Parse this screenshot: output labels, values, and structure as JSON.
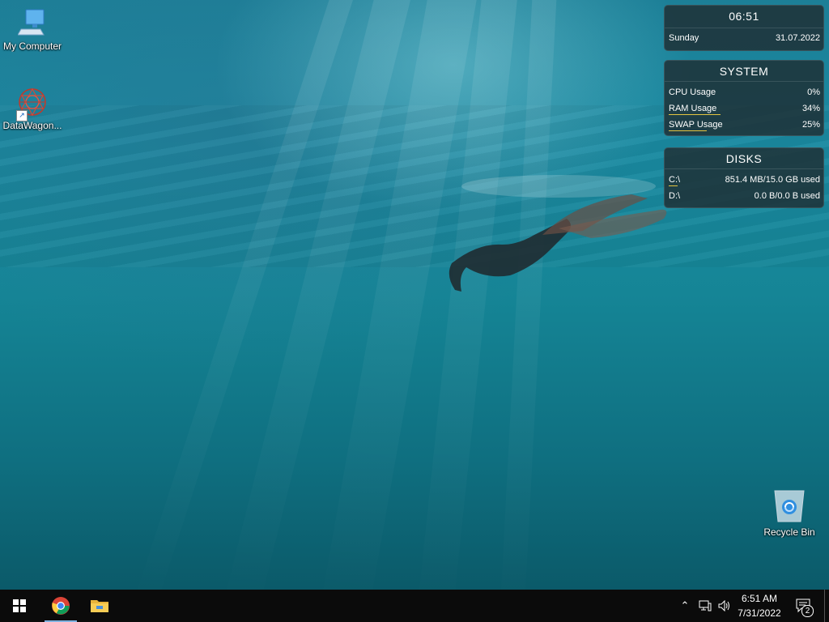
{
  "desktop": {
    "icons": [
      {
        "label": "My Computer",
        "icon": "computer-icon"
      },
      {
        "label": "DataWagon...",
        "icon": "datawagon-app-icon"
      },
      {
        "label": "Recycle Bin",
        "icon": "recycle-bin-icon"
      }
    ]
  },
  "widgets": {
    "clock": {
      "time": "06:51",
      "day": "Sunday",
      "date": "31.07.2022"
    },
    "system": {
      "title": "SYSTEM",
      "rows": [
        {
          "label": "CPU Usage",
          "value": "0%",
          "fraction": 0.0
        },
        {
          "label": "RAM Usage",
          "value": "34%",
          "fraction": 0.34
        },
        {
          "label": "SWAP Usage",
          "value": "25%",
          "fraction": 0.25
        }
      ]
    },
    "disks": {
      "title": "DISKS",
      "rows": [
        {
          "label": "C:\\",
          "value": "851.4 MB/15.0 GB used",
          "fraction": 0.057
        },
        {
          "label": "D:\\",
          "value": "0.0 B/0.0 B used",
          "fraction": 0.0
        }
      ]
    }
  },
  "taskbar": {
    "apps": [
      {
        "name": "Start",
        "icon": "windows-start-icon"
      },
      {
        "name": "Google Chrome",
        "icon": "chrome-icon",
        "active": true
      },
      {
        "name": "File Explorer",
        "icon": "file-explorer-icon"
      }
    ],
    "tray": {
      "icons": [
        "chevron-up-icon",
        "network-icon",
        "volume-icon"
      ],
      "time": "6:51 AM",
      "date": "7/31/2022",
      "notification_count": "2"
    }
  },
  "colors": {
    "accent_bar": "#e3c440",
    "taskbar_bg": "#0b0b0b",
    "active_indicator": "#7fb2e0"
  }
}
